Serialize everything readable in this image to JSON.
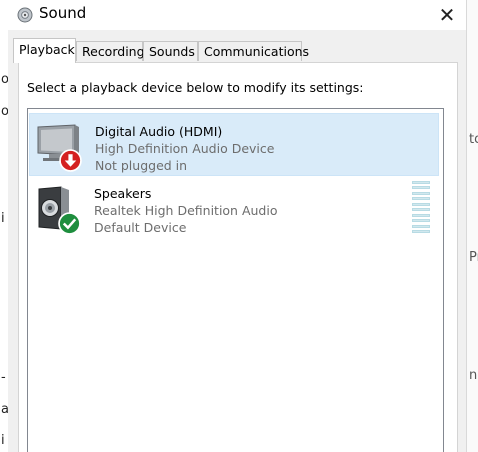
{
  "background": {
    "left_fragments": [
      "o",
      "o",
      "i",
      "-",
      "a",
      "i"
    ],
    "right_fragments": [
      "to",
      "Pr",
      "nc"
    ]
  },
  "window": {
    "title": "Sound",
    "icon": "speaker-icon",
    "close_symbol": "✕"
  },
  "tabs": [
    {
      "label": "Playback",
      "active": true
    },
    {
      "label": "Recording",
      "active": false
    },
    {
      "label": "Sounds",
      "active": false
    },
    {
      "label": "Communications",
      "active": false
    }
  ],
  "instruction": "Select a playback device below to modify its settings:",
  "devices": [
    {
      "name": "Digital Audio (HDMI)",
      "driver": "High Definition Audio Device",
      "status": "Not plugged in",
      "icon": "monitor-icon",
      "badge": "red-down-arrow-icon",
      "selected": true
    },
    {
      "name": "Speakers",
      "driver": "Realtek High Definition Audio",
      "status": "Default Device",
      "icon": "speaker-box-icon",
      "badge": "green-check-icon",
      "selected": false
    }
  ],
  "level_meter": {
    "level": 0,
    "segments": 10
  },
  "colors": {
    "selection": "#d9ebf9",
    "badge_red": "#d42020",
    "badge_green": "#1e8e3e",
    "meter": "#d1e8ee"
  }
}
